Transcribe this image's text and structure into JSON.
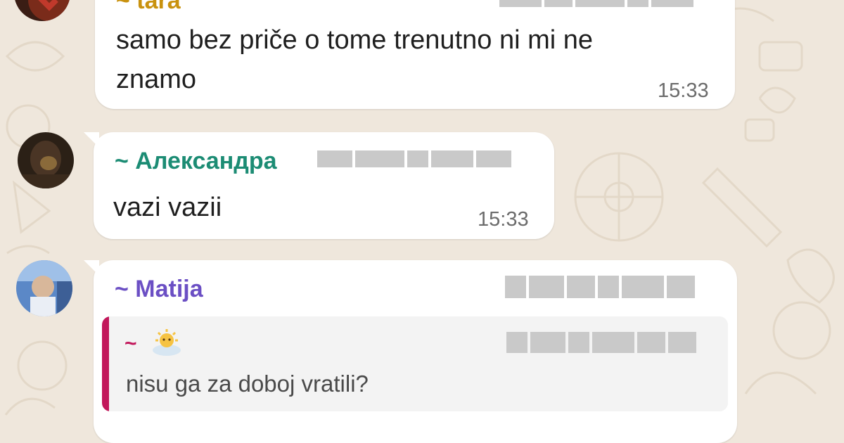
{
  "messages": [
    {
      "sender": "~ tara",
      "text_lines": [
        "samo bez priče o tome trenutno ni mi ne",
        "znamo"
      ],
      "time": "15:33"
    },
    {
      "sender": "~ Александра",
      "sender_color": "#1c8c74",
      "text": "vazi vazii",
      "time": "15:33"
    },
    {
      "sender": "~ Matija",
      "sender_color": "#6b4fc4",
      "reply": {
        "sender": "~",
        "text": "nisu ga za doboj vratili?",
        "bar_color": "#c2185b"
      }
    }
  ],
  "colors": {
    "background": "#efe7dc",
    "bubble": "#ffffff",
    "time_text": "#6b6b6b"
  }
}
